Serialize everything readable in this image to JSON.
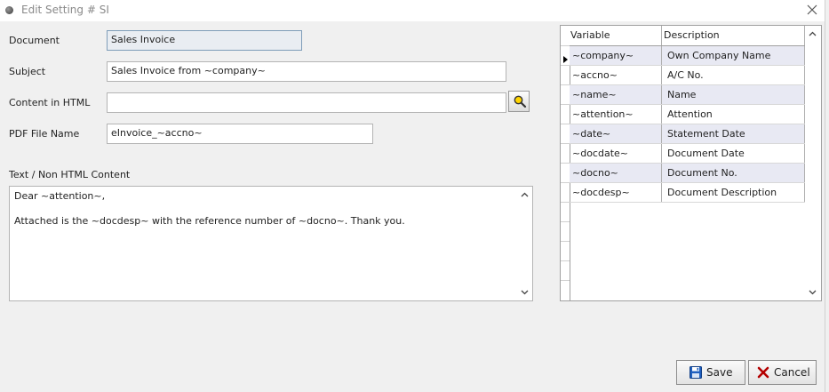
{
  "window": {
    "title": "Edit Setting # SI"
  },
  "form": {
    "document_label": "Document",
    "document_value": "Sales Invoice",
    "subject_label": "Subject",
    "subject_value": "Sales Invoice from ~company~",
    "content_html_label": "Content in HTML",
    "content_html_value": "",
    "pdf_label": "PDF File Name",
    "pdf_value": "eInvoice_~accno~",
    "text_label": "Text / Non HTML Content",
    "text_lines": [
      "Dear ~attention~,",
      "",
      "Attached is the ~docdesp~ with the reference number of ~docno~. Thank you."
    ]
  },
  "grid": {
    "columns": [
      "Variable",
      "Description"
    ],
    "rows": [
      [
        "~company~",
        "Own Company Name"
      ],
      [
        "~accno~",
        "A/C No."
      ],
      [
        "~name~",
        "Name"
      ],
      [
        "~attention~",
        "Attention"
      ],
      [
        "~date~",
        "Statement Date"
      ],
      [
        "~docdate~",
        "Document Date"
      ],
      [
        "~docno~",
        "Document No."
      ],
      [
        "~docdesp~",
        "Document Description"
      ]
    ]
  },
  "buttons": {
    "save": "Save",
    "cancel": "Cancel"
  },
  "icons": {
    "window": "window-dot-icon",
    "close": "close-icon",
    "lookup": "magnifier-icon",
    "save": "floppy-disk-icon",
    "cancel": "red-x-icon"
  },
  "colors": {
    "alt_row": "#e8e9f3",
    "readonly_field": "#e9edf2",
    "cancel_icon": "#b40000",
    "save_icon": "#1f5fbf"
  }
}
